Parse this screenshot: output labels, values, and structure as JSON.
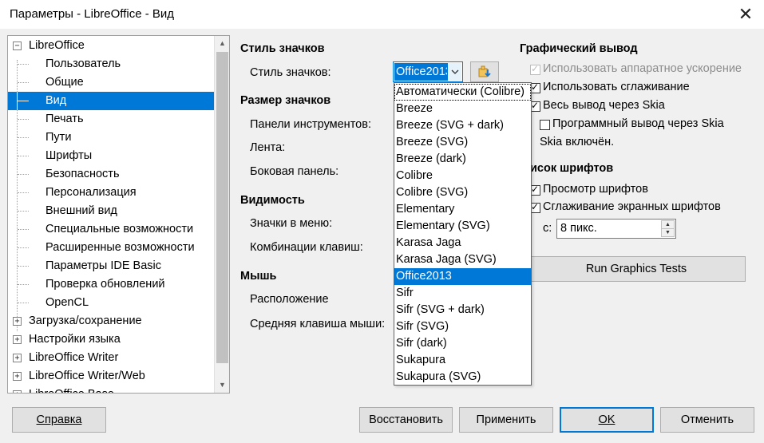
{
  "window": {
    "title": "Параметры - LibreOffice - Вид",
    "close_glyph": "✕"
  },
  "tree": {
    "items": [
      {
        "label": "LibreOffice",
        "level": 0,
        "expander": "−"
      },
      {
        "label": "Пользователь",
        "level": 1
      },
      {
        "label": "Общие",
        "level": 1
      },
      {
        "label": "Вид",
        "level": 1,
        "selected": true
      },
      {
        "label": "Печать",
        "level": 1
      },
      {
        "label": "Пути",
        "level": 1
      },
      {
        "label": "Шрифты",
        "level": 1
      },
      {
        "label": "Безопасность",
        "level": 1
      },
      {
        "label": "Персонализация",
        "level": 1
      },
      {
        "label": "Внешний вид",
        "level": 1
      },
      {
        "label": "Специальные возможности",
        "level": 1
      },
      {
        "label": "Расширенные возможности",
        "level": 1
      },
      {
        "label": "Параметры IDE Basic",
        "level": 1
      },
      {
        "label": "Проверка обновлений",
        "level": 1
      },
      {
        "label": "OpenCL",
        "level": 1
      },
      {
        "label": "Загрузка/сохранение",
        "level": 0,
        "expander": "+"
      },
      {
        "label": "Настройки языка",
        "level": 0,
        "expander": "+"
      },
      {
        "label": "LibreOffice Writer",
        "level": 0,
        "expander": "+"
      },
      {
        "label": "LibreOffice Writer/Web",
        "level": 0,
        "expander": "+"
      },
      {
        "label": "LibreOffice Base",
        "level": 0,
        "expander": "+"
      }
    ]
  },
  "main": {
    "icon_style_head": "Стиль значков",
    "icon_style_label": "Стиль значков:",
    "icon_style_value": "Office2013",
    "icon_size_head": "Размер значков",
    "toolbar_label": "Панели инструментов:",
    "ribbon_label": "Лента:",
    "sidebar_label": "Боковая панель:",
    "visibility_head": "Видимость",
    "menu_icons_label": "Значки в меню:",
    "shortcuts_label": "Комбинации клавиш:",
    "mouse_head": "Мышь",
    "position_label": "Расположение",
    "middle_button_label": "Средняя клавиша мыши:"
  },
  "dropdown": {
    "items": [
      "Автоматически (Colibre)",
      "Breeze",
      "Breeze (SVG + dark)",
      "Breeze (SVG)",
      "Breeze (dark)",
      "Colibre",
      "Colibre (SVG)",
      "Elementary",
      "Elementary (SVG)",
      "Karasa Jaga",
      "Karasa Jaga (SVG)",
      "Office2013",
      "Sifr",
      "Sifr (SVG + dark)",
      "Sifr (SVG)",
      "Sifr (dark)",
      "Sukapura",
      "Sukapura (SVG)"
    ],
    "selected_index": 11
  },
  "graphics": {
    "head": "Графический вывод",
    "hw_accel": "Использовать аппаратное ускорение",
    "antialias": "Использовать сглаживание",
    "skia_all": "Весь вывод через Skia",
    "skia_software": "Программный вывод через Skia",
    "skia_status": "Skia включён.",
    "fonts_head": "исок шрифтов",
    "font_preview": "Просмотр шрифтов",
    "font_aa": "Сглаживание экранных шрифтов",
    "from_label": "с:",
    "from_value": "8 пикс.",
    "run_tests": "Run Graphics Tests"
  },
  "buttons": {
    "help": "Справка",
    "reset": "Восстановить",
    "apply": "Применить",
    "ok": "OK",
    "cancel": "Отменить"
  }
}
